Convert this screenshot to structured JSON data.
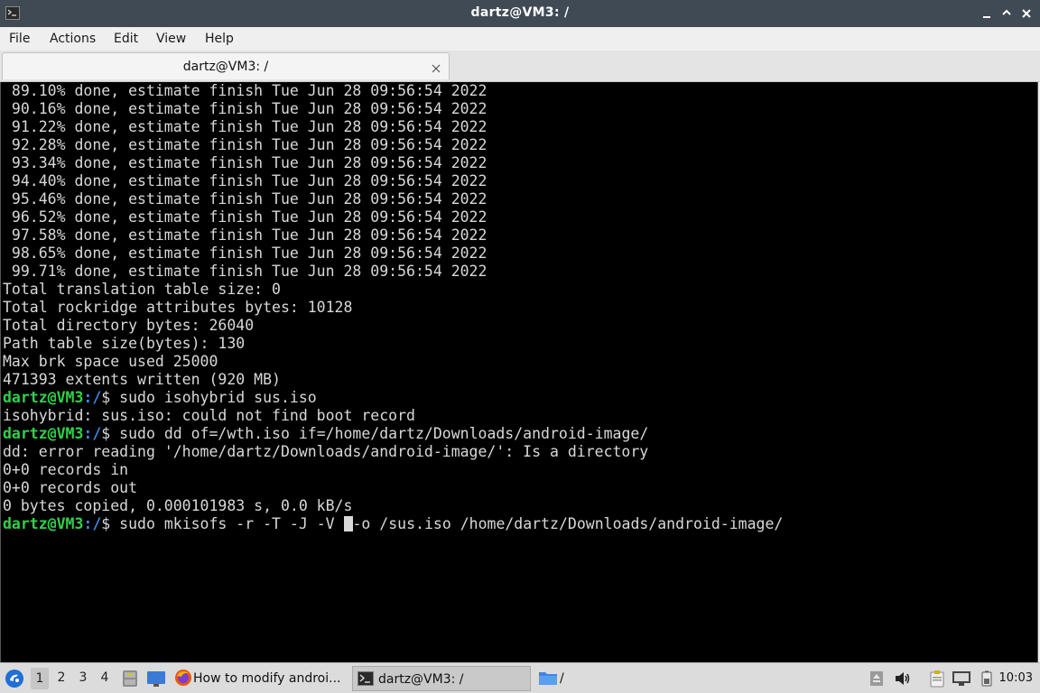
{
  "window": {
    "title": "dartz@VM3: /"
  },
  "menu": [
    "File",
    "Actions",
    "Edit",
    "View",
    "Help"
  ],
  "tab": {
    "label": "dartz@VM3: /"
  },
  "terminal": {
    "progress_lines": [
      " 89.10% done, estimate finish Tue Jun 28 09:56:54 2022",
      " 90.16% done, estimate finish Tue Jun 28 09:56:54 2022",
      " 91.22% done, estimate finish Tue Jun 28 09:56:54 2022",
      " 92.28% done, estimate finish Tue Jun 28 09:56:54 2022",
      " 93.34% done, estimate finish Tue Jun 28 09:56:54 2022",
      " 94.40% done, estimate finish Tue Jun 28 09:56:54 2022",
      " 95.46% done, estimate finish Tue Jun 28 09:56:54 2022",
      " 96.52% done, estimate finish Tue Jun 28 09:56:54 2022",
      " 97.58% done, estimate finish Tue Jun 28 09:56:54 2022",
      " 98.65% done, estimate finish Tue Jun 28 09:56:54 2022",
      " 99.71% done, estimate finish Tue Jun 28 09:56:54 2022"
    ],
    "summary_lines": [
      "Total translation table size: 0",
      "Total rockridge attributes bytes: 10128",
      "Total directory bytes: 26040",
      "Path table size(bytes): 130",
      "Max brk space used 25000",
      "471393 extents written (920 MB)"
    ],
    "prompt_user": "dartz@VM3",
    "prompt_path": ":/",
    "prompt_symbol": "$",
    "cmd1": " sudo isohybrid sus.iso",
    "out1": "isohybrid: sus.iso: could not find boot record",
    "cmd2": " sudo dd of=/wth.iso if=/home/dartz/Downloads/android-image/",
    "out2": [
      "dd: error reading '/home/dartz/Downloads/android-image/': Is a directory",
      "0+0 records in",
      "0+0 records out",
      "0 bytes copied, 0.000101983 s, 0.0 kB/s"
    ],
    "cmd3_before_cursor": " sudo mkisofs -r -T -J -V ",
    "cmd3_after_cursor": "-o /sus.iso /home/dartz/Downloads/android-image/"
  },
  "taskbar": {
    "workspaces": [
      "1",
      "2",
      "3",
      "4"
    ],
    "active_workspace": "1",
    "tasks": [
      {
        "label": "How to modify androi...",
        "icon": "firefox-icon"
      },
      {
        "label": "dartz@VM3: /",
        "icon": "terminal-icon"
      },
      {
        "label": "/",
        "icon": "folder-icon"
      }
    ],
    "clock": "10:03"
  },
  "colors": {
    "prompt_user": "#2fd14a",
    "prompt_path": "#3f86e8",
    "terminal_bg": "#000000",
    "terminal_fg": "#d8d8d8",
    "titlebar_bg": "#404a54"
  }
}
